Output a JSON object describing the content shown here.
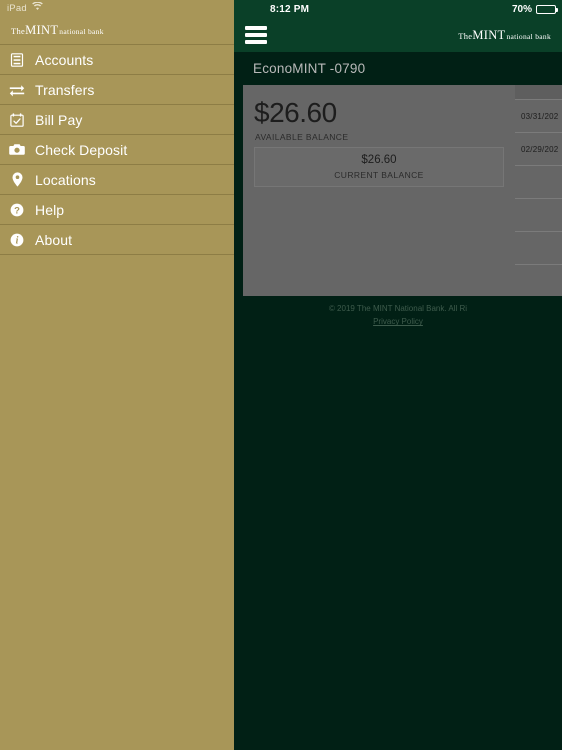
{
  "device": {
    "name": "iPad",
    "wifi_icon": "wifi-icon",
    "time": "8:12 PM",
    "battery_percent": "70%",
    "battery_level": 70
  },
  "brand": {
    "the": "The",
    "mint": "MINT",
    "national_bank": "national bank"
  },
  "drawer": {
    "menu_icon": "hamburger-icon",
    "items": [
      {
        "label": "Accounts",
        "icon": "accounts-ledger-icon"
      },
      {
        "label": "Transfers",
        "icon": "transfer-arrows-icon"
      },
      {
        "label": "Bill Pay",
        "icon": "calendar-check-icon"
      },
      {
        "label": "Check Deposit",
        "icon": "camera-icon"
      },
      {
        "label": "Locations",
        "icon": "map-pin-icon"
      },
      {
        "label": "Help",
        "icon": "question-circle-icon"
      },
      {
        "label": "About",
        "icon": "info-circle-icon"
      }
    ]
  },
  "account": {
    "title": "EconoMINT -0790",
    "available_amount": "$26.60",
    "available_label": "AVAILABLE BALANCE",
    "current_amount": "$26.60",
    "current_label": "CURRENT BALANCE"
  },
  "statements": {
    "rows": [
      {
        "date": "03/31/202"
      },
      {
        "date": "02/29/202"
      },
      {
        "date": ""
      },
      {
        "date": ""
      },
      {
        "date": ""
      },
      {
        "date": ""
      }
    ]
  },
  "footer": {
    "copyright": "© 2019 The MINT National Bank. All Ri",
    "privacy": "Privacy Policy"
  },
  "colors": {
    "gold": "#a89658",
    "dark_green": "#012015",
    "header_green": "#0a4028",
    "card_gray": "#666666"
  }
}
